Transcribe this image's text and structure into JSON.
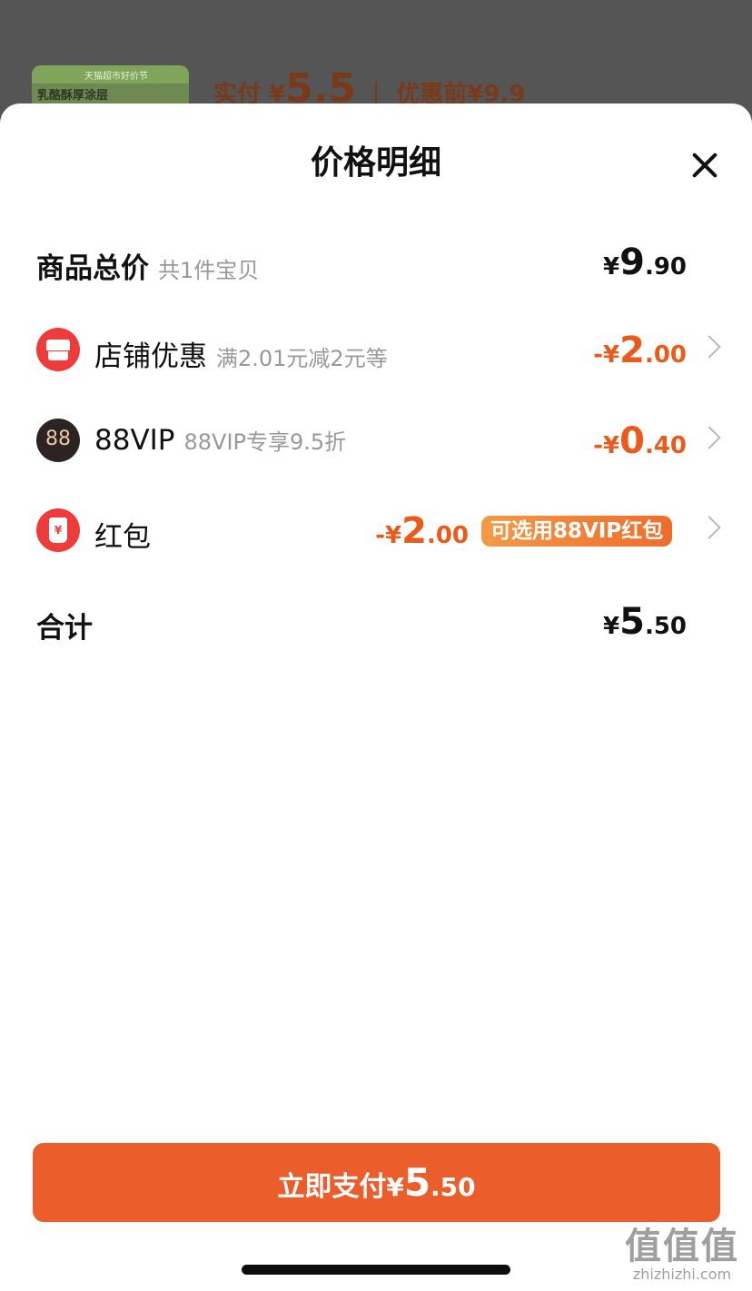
{
  "background": {
    "thumb_caption": "天猫超市好价节",
    "thumb_label": "乳酪酥厚涂层",
    "paid_label": "实付",
    "paid_currency": "¥",
    "paid_amount": "5.5",
    "before_label": "优惠前",
    "before_currency": "¥",
    "before_amount": "9.9"
  },
  "sheet": {
    "title": "价格明细",
    "close_icon": "close-icon"
  },
  "rows": {
    "total_goods": {
      "label": "商品总价",
      "sub": "共1件宝贝",
      "currency": "¥",
      "int": "9",
      "dec": ".90"
    },
    "shop_discount": {
      "label": "店铺优惠",
      "sub": "满2.01元减2元等",
      "currency": "-¥",
      "int": "2",
      "dec": ".00",
      "icon": "shop-icon"
    },
    "vip": {
      "label": "88VIP",
      "sub": "88VIP专享9.5折",
      "currency": "-¥",
      "int": "0",
      "dec": ".40",
      "icon": "vip-icon",
      "icon_text": "88"
    },
    "red_packet": {
      "label": "红包",
      "currency": "-¥",
      "int": "2",
      "dec": ".00",
      "badge": "可选用88VIP红包",
      "icon": "red-packet-icon",
      "icon_text": "¥"
    },
    "sum": {
      "label": "合计",
      "currency": "¥",
      "int": "5",
      "dec": ".50"
    }
  },
  "pay_button": {
    "label": "立即支付",
    "currency": "¥",
    "int": "5",
    "dec": ".50"
  },
  "watermark": {
    "big": "值值值",
    "small": "zhizhizhi.com"
  },
  "colors": {
    "accent": "#eb5e2c",
    "discount": "#ea5a1b",
    "badge_from": "#f39a46",
    "badge_to": "#ef6c2b"
  }
}
